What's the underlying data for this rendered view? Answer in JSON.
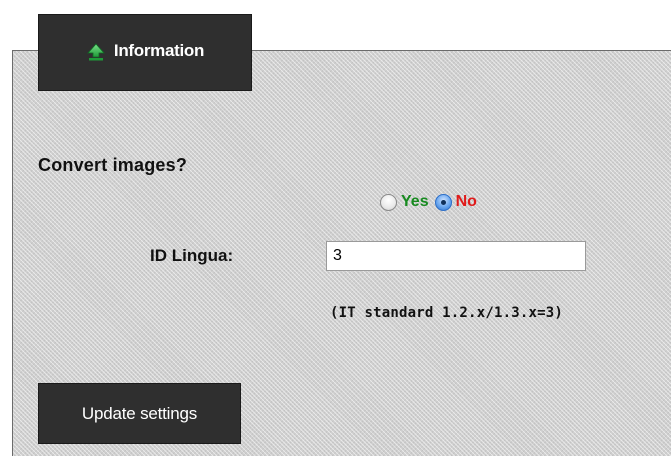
{
  "tab": {
    "label": "Information",
    "icon": "arrow-up-icon",
    "icon_color": "#2db84a"
  },
  "form": {
    "convert_images": {
      "label": "Convert images?",
      "options": [
        {
          "label": "Yes",
          "selected": false,
          "color": "#178a1f"
        },
        {
          "label": "No",
          "selected": true,
          "color": "#e01b1b"
        }
      ]
    },
    "id_lingua": {
      "label": "ID Lingua:",
      "value": "3",
      "hint": "(IT standard 1.2.x/1.3.x=3)"
    },
    "submit_label": "Update settings"
  }
}
